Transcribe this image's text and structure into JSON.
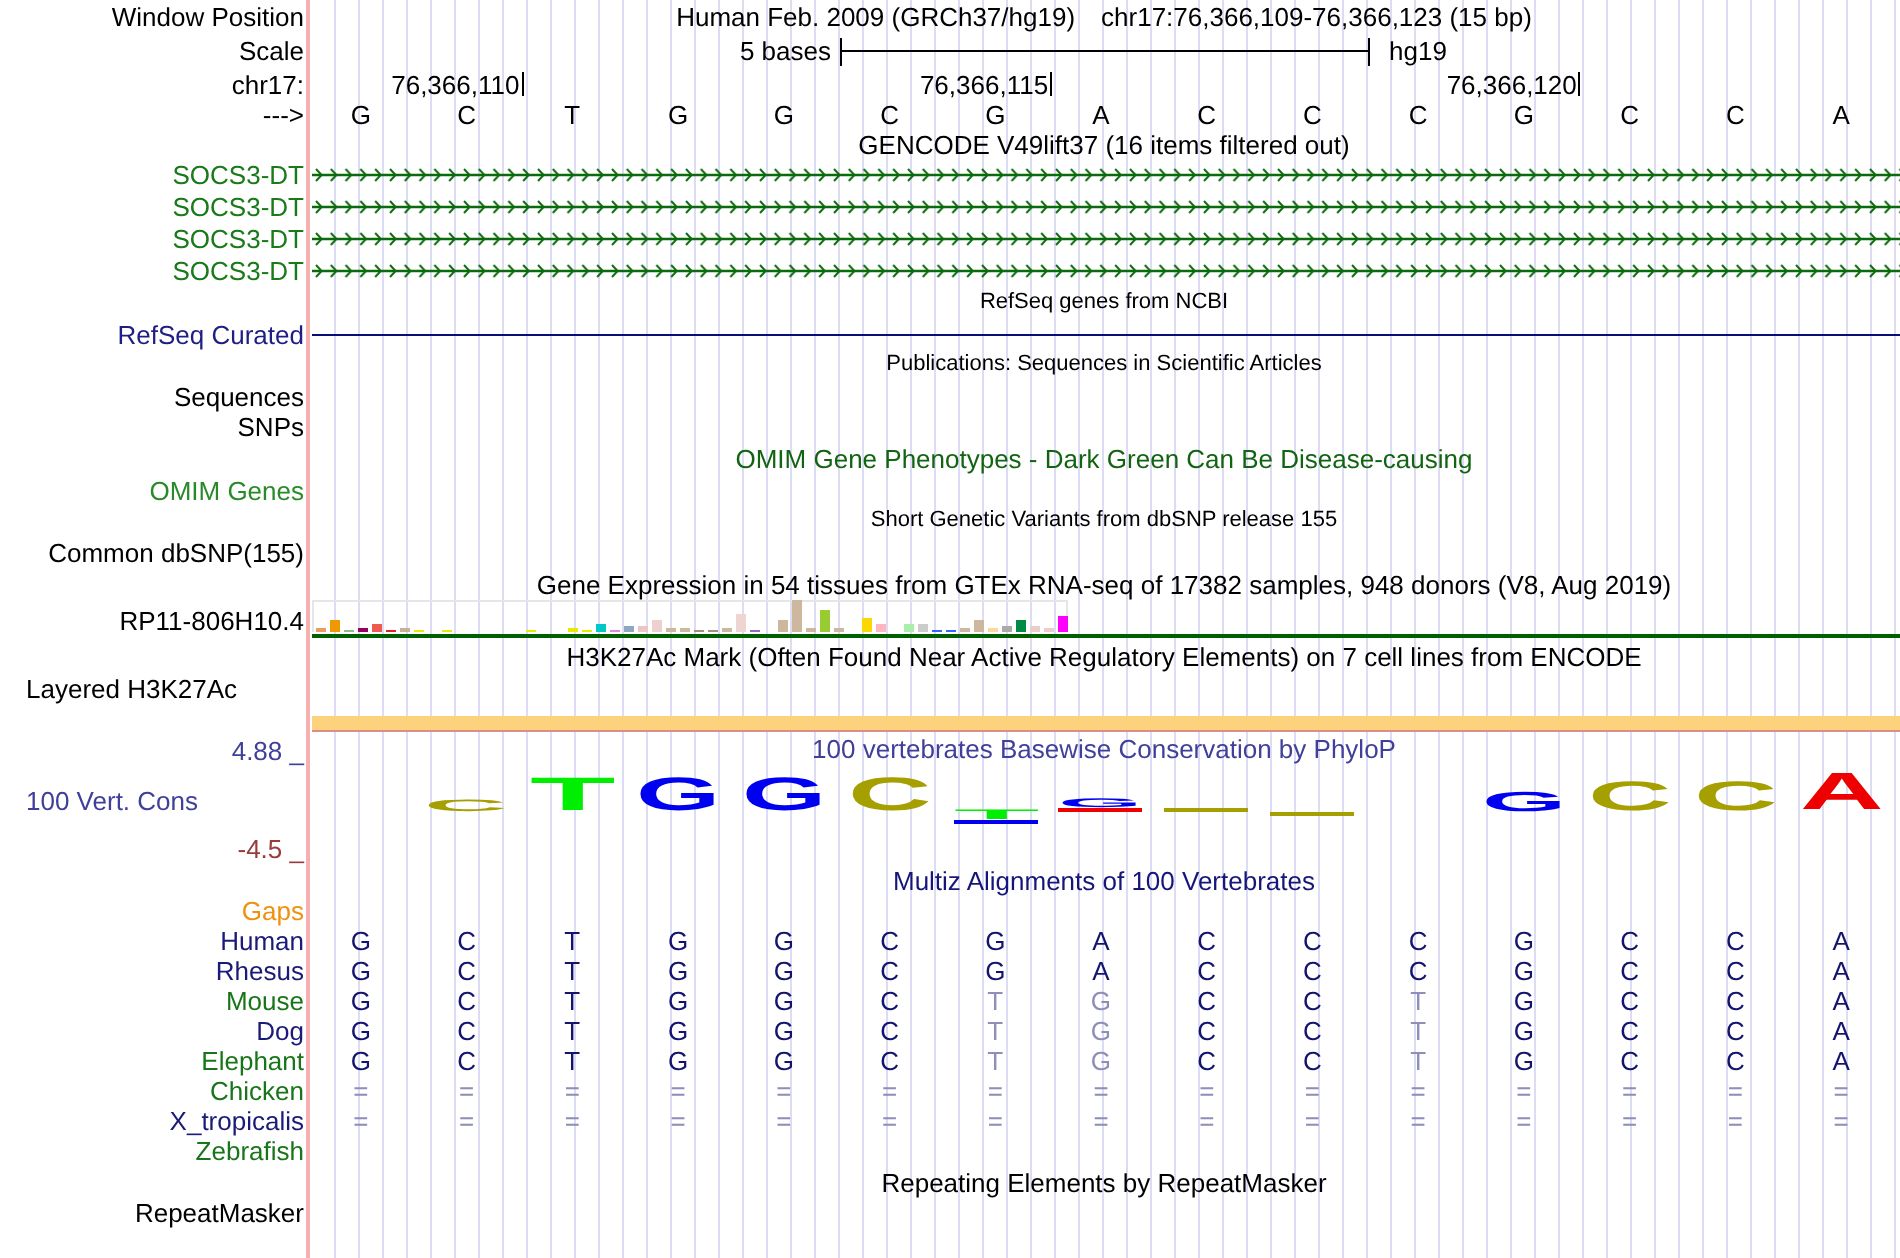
{
  "header": {
    "position_label": "Window Position",
    "assembly": "Human Feb. 2009 (GRCh37/hg19)",
    "position": "chr17:76,366,109-76,366,123 (15 bp)",
    "scale_label": "Scale",
    "scale_span": "5 bases",
    "scale_assembly": "hg19",
    "ruler_label": "chr17:",
    "ruler_ticks": [
      "76,366,110",
      "76,366,115",
      "76,366,120"
    ],
    "strand_label": "--->",
    "bases": [
      "G",
      "C",
      "T",
      "G",
      "G",
      "C",
      "G",
      "A",
      "C",
      "C",
      "C",
      "G",
      "C",
      "C",
      "A"
    ]
  },
  "tracks": [
    {
      "kind": "genes",
      "title": "GENCODE V49lift37 (16 items filtered out)",
      "items": [
        {
          "label": "SOCS3-DT"
        },
        {
          "label": "SOCS3-DT"
        },
        {
          "label": "SOCS3-DT"
        },
        {
          "label": "SOCS3-DT"
        }
      ]
    },
    {
      "kind": "refseq",
      "title": "RefSeq genes from NCBI",
      "items": [
        {
          "label": "RefSeq Curated"
        }
      ]
    },
    {
      "kind": "publications",
      "title": "Publications: Sequences in Scientific Articles",
      "items": [
        {
          "label": "Sequences"
        },
        {
          "label": "SNPs"
        }
      ]
    },
    {
      "kind": "omim",
      "title": "OMIM Gene Phenotypes - Dark Green Can Be Disease-causing",
      "items": [
        {
          "label": "OMIM Genes"
        }
      ]
    },
    {
      "kind": "variants",
      "title": "Short Genetic Variants from dbSNP release 155",
      "items": [
        {
          "label": "Common dbSNP(155)"
        }
      ]
    },
    {
      "kind": "expression",
      "title": "Gene Expression in 54 tissues from GTEx RNA-seq of 17382 samples, 948 donors (V8, Aug 2019)",
      "items": [
        {
          "label": "RP11-806H10.4"
        }
      ]
    },
    {
      "kind": "signal",
      "title": "H3K27Ac Mark (Often Found Near Active Regulatory Elements) on 7 cell lines from ENCODE",
      "label": "Layered H3K27Ac"
    },
    {
      "kind": "conservation",
      "title": "100 vertebrates Basewise Conservation by PhyloP",
      "label": "100 Vert. Cons",
      "max": "4.88 _",
      "min": "-4.5 _",
      "logo": [
        {
          "stack": [
            {
              "kind": "letter",
              "base": "C",
              "color": "#a59f00"
            }
          ]
        },
        {
          "stack": [
            {
              "kind": "letter",
              "base": "T",
              "color": "#00ee00"
            }
          ]
        },
        {
          "stack": [
            {
              "kind": "letter",
              "base": "G",
              "color": "#0000f0"
            }
          ]
        },
        {
          "stack": [
            {
              "kind": "letter",
              "base": "G",
              "color": "#0000f0"
            }
          ]
        },
        {
          "stack": [
            {
              "kind": "letter",
              "base": "C",
              "color": "#a59f00"
            }
          ]
        },
        {
          "stack": [
            {
              "kind": "letter",
              "base": "T",
              "color": "#00ee00"
            },
            {
              "kind": "sliver",
              "color": "#0000f0"
            }
          ]
        },
        {
          "stack": [
            {
              "kind": "letter",
              "base": "G",
              "color": "#0000f0"
            },
            {
              "kind": "sliver",
              "color": "#ee0000"
            }
          ]
        },
        {
          "stack": [
            {
              "kind": "sliver",
              "color": "#a59f00"
            }
          ]
        },
        {
          "stack": [
            {
              "kind": "sliver",
              "color": "#a59f00"
            }
          ]
        },
        {
          "stack": [
            {
              "kind": "letter",
              "base": "G",
              "color": "#0000f0"
            }
          ]
        },
        {
          "stack": [
            {
              "kind": "letter",
              "base": "C",
              "color": "#a59f00"
            }
          ]
        },
        {
          "stack": [
            {
              "kind": "letter",
              "base": "C",
              "color": "#a59f00"
            }
          ]
        },
        {
          "stack": [
            {
              "kind": "letter",
              "base": "A",
              "color": "#ee0000"
            }
          ]
        }
      ]
    },
    {
      "kind": "alignment",
      "title": "Multiz Alignments of 100 Vertebrates",
      "gaps_label": "Gaps",
      "species": [
        {
          "name": "Human",
          "color": "#1a1a78",
          "bases": [
            {
              "base": "G",
              "faded": false
            },
            {
              "base": "C",
              "faded": false
            },
            {
              "base": "T",
              "faded": false
            },
            {
              "base": "G",
              "faded": false
            },
            {
              "base": "G",
              "faded": false
            },
            {
              "base": "C",
              "faded": false
            },
            {
              "base": "G",
              "faded": false
            },
            {
              "base": "A",
              "faded": false
            },
            {
              "base": "C",
              "faded": false
            },
            {
              "base": "C",
              "faded": false
            },
            {
              "base": "C",
              "faded": false
            },
            {
              "base": "G",
              "faded": false
            },
            {
              "base": "C",
              "faded": false
            },
            {
              "base": "C",
              "faded": false
            },
            {
              "base": "A",
              "faded": false
            }
          ]
        },
        {
          "name": "Rhesus",
          "color": "#1a1a78",
          "bases": [
            {
              "base": "G",
              "faded": false
            },
            {
              "base": "C",
              "faded": false
            },
            {
              "base": "T",
              "faded": false
            },
            {
              "base": "G",
              "faded": false
            },
            {
              "base": "G",
              "faded": false
            },
            {
              "base": "C",
              "faded": false
            },
            {
              "base": "G",
              "faded": false
            },
            {
              "base": "A",
              "faded": false
            },
            {
              "base": "C",
              "faded": false
            },
            {
              "base": "C",
              "faded": false
            },
            {
              "base": "C",
              "faded": false
            },
            {
              "base": "G",
              "faded": false
            },
            {
              "base": "C",
              "faded": false
            },
            {
              "base": "C",
              "faded": false
            },
            {
              "base": "A",
              "faded": false
            }
          ]
        },
        {
          "name": "Mouse",
          "color": "#197519",
          "bases": [
            {
              "base": "G",
              "faded": false
            },
            {
              "base": "C",
              "faded": false
            },
            {
              "base": "T",
              "faded": false
            },
            {
              "base": "G",
              "faded": false
            },
            {
              "base": "G",
              "faded": false
            },
            {
              "base": "C",
              "faded": false
            },
            {
              "base": "T",
              "faded": true
            },
            {
              "base": "G",
              "faded": true
            },
            {
              "base": "C",
              "faded": false
            },
            {
              "base": "C",
              "faded": false
            },
            {
              "base": "T",
              "faded": true
            },
            {
              "base": "G",
              "faded": false
            },
            {
              "base": "C",
              "faded": false
            },
            {
              "base": "C",
              "faded": false
            },
            {
              "base": "A",
              "faded": false
            }
          ]
        },
        {
          "name": "Dog",
          "color": "#1a1a78",
          "bases": [
            {
              "base": "G",
              "faded": false
            },
            {
              "base": "C",
              "faded": false
            },
            {
              "base": "T",
              "faded": false
            },
            {
              "base": "G",
              "faded": false
            },
            {
              "base": "G",
              "faded": false
            },
            {
              "base": "C",
              "faded": false
            },
            {
              "base": "T",
              "faded": true
            },
            {
              "base": "G",
              "faded": true
            },
            {
              "base": "C",
              "faded": false
            },
            {
              "base": "C",
              "faded": false
            },
            {
              "base": "T",
              "faded": true
            },
            {
              "base": "G",
              "faded": false
            },
            {
              "base": "C",
              "faded": false
            },
            {
              "base": "C",
              "faded": false
            },
            {
              "base": "A",
              "faded": false
            }
          ]
        },
        {
          "name": "Elephant",
          "color": "#197519",
          "bases": [
            {
              "base": "G",
              "faded": false
            },
            {
              "base": "C",
              "faded": false
            },
            {
              "base": "T",
              "faded": false
            },
            {
              "base": "G",
              "faded": false
            },
            {
              "base": "G",
              "faded": false
            },
            {
              "base": "C",
              "faded": false
            },
            {
              "base": "T",
              "faded": true
            },
            {
              "base": "G",
              "faded": true
            },
            {
              "base": "C",
              "faded": false
            },
            {
              "base": "C",
              "faded": false
            },
            {
              "base": "T",
              "faded": true
            },
            {
              "base": "G",
              "faded": false
            },
            {
              "base": "C",
              "faded": false
            },
            {
              "base": "C",
              "faded": false
            },
            {
              "base": "A",
              "faded": false
            }
          ]
        },
        {
          "name": "Chicken",
          "color": "#197519",
          "bases": [
            {
              "base": "=",
              "faded": true
            },
            {
              "base": "=",
              "faded": true
            },
            {
              "base": "=",
              "faded": true
            },
            {
              "base": "=",
              "faded": true
            },
            {
              "base": "=",
              "faded": true
            },
            {
              "base": "=",
              "faded": true
            },
            {
              "base": "=",
              "faded": true
            },
            {
              "base": "=",
              "faded": true
            },
            {
              "base": "=",
              "faded": true
            },
            {
              "base": "=",
              "faded": true
            },
            {
              "base": "=",
              "faded": true
            },
            {
              "base": "=",
              "faded": true
            },
            {
              "base": "=",
              "faded": true
            },
            {
              "base": "=",
              "faded": true
            },
            {
              "base": "=",
              "faded": true
            }
          ]
        },
        {
          "name": "X_tropicalis",
          "color": "#1a1a78",
          "bases": [
            {
              "base": "=",
              "faded": true
            },
            {
              "base": "=",
              "faded": true
            },
            {
              "base": "=",
              "faded": true
            },
            {
              "base": "=",
              "faded": true
            },
            {
              "base": "=",
              "faded": true
            },
            {
              "base": "=",
              "faded": true
            },
            {
              "base": "=",
              "faded": true
            },
            {
              "base": "=",
              "faded": true
            },
            {
              "base": "=",
              "faded": true
            },
            {
              "base": "=",
              "faded": true
            },
            {
              "base": "=",
              "faded": true
            },
            {
              "base": "=",
              "faded": true
            },
            {
              "base": "=",
              "faded": true
            },
            {
              "base": "=",
              "faded": true
            },
            {
              "base": "=",
              "faded": true
            }
          ]
        },
        {
          "name": "Zebrafish",
          "color": "#197519"
        }
      ]
    },
    {
      "kind": "repeats",
      "title": "Repeating Elements by RepeatMasker",
      "label": "RepeatMasker"
    }
  ]
}
